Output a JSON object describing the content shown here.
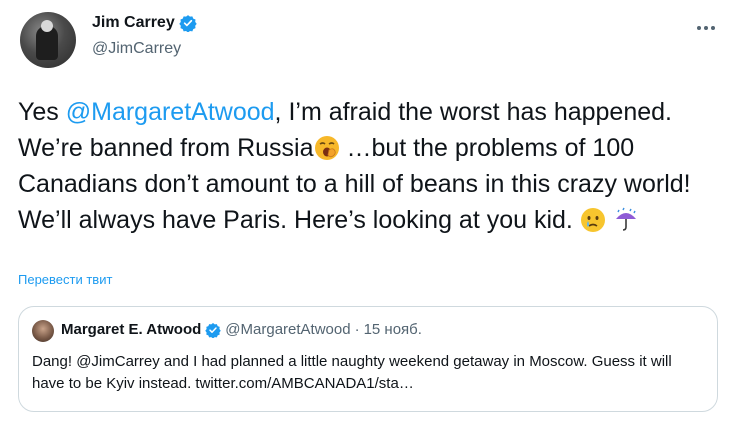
{
  "author": {
    "name": "Jim Carrey",
    "handle": "@JimCarrey"
  },
  "tweet": {
    "part1": "Yes ",
    "mention": "@MargaretAtwood",
    "part2": ", I’m afraid the worst has happened. We’re banned from Russia",
    "part3": " …but the problems of 100 Canadians don’t amount to a hill of beans in this crazy world! We’ll always have Paris. Here’s looking at you kid. "
  },
  "translate_label": "Перевести твит",
  "quote": {
    "name": "Margaret E. Atwood",
    "handle": "@MargaretAtwood",
    "separator": "·",
    "date": "15 нояб.",
    "text": "Dang! @JimCarrey and I had planned a little naughty weekend getaway in Moscow. Guess it will have to be Kyiv instead. twitter.com/AMBCANADA1/sta…"
  },
  "icons": {
    "verified": "verified-badge-icon",
    "more": "more-options-icon",
    "emoji1": "yawning-face-emoji",
    "emoji2": "crying-face-emoji",
    "emoji3": "umbrella-with-rain-emoji"
  },
  "colors": {
    "accent": "#1d9bf0",
    "text": "#0f1419",
    "secondary": "#536471",
    "border": "#cfd9de"
  }
}
